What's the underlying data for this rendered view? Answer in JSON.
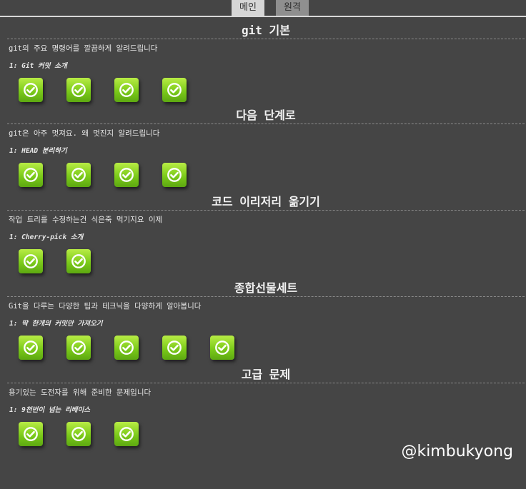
{
  "tabs": [
    {
      "label": "메인",
      "active": true
    },
    {
      "label": "원격",
      "active": false
    }
  ],
  "sections": [
    {
      "title": "git 기본",
      "description": "git의 주요 명령어를 깔끔하게 알려드립니다",
      "level_name": "1: Git 커밋 소개",
      "level_count": 4
    },
    {
      "title": "다음 단계로",
      "description": "git은 아주 멋져요. 왜 멋진지 알려드립니다",
      "level_name": "1: HEAD 분리하기",
      "level_count": 4
    },
    {
      "title": "코드 이리저리 옮기기",
      "description": "작업 트리를 수정하는건 식은죽 먹기지요 이제",
      "level_name": "1: Cherry-pick 소개",
      "level_count": 2
    },
    {
      "title": "종합선물세트",
      "description": "Git을 다루는 다양한 팁과 테크닉을 다양하게 알아봅니다",
      "level_name": "1: 딱 한개의 커밋만 가져오기",
      "level_count": 5
    },
    {
      "title": "고급 문제",
      "description": "용기있는 도전자를 위해 준비한 문제입니다",
      "level_name": "1: 9천번이 넘는 리베이스",
      "level_count": 3
    }
  ],
  "level_status": "completed",
  "level_icon": "check-circle-icon",
  "colors": {
    "background": "#454545",
    "level_button": "#7ccb1a",
    "tab_active": "#d6d6d6",
    "tab_inactive": "#8f8f8f"
  },
  "watermark": "@kimbukyong"
}
